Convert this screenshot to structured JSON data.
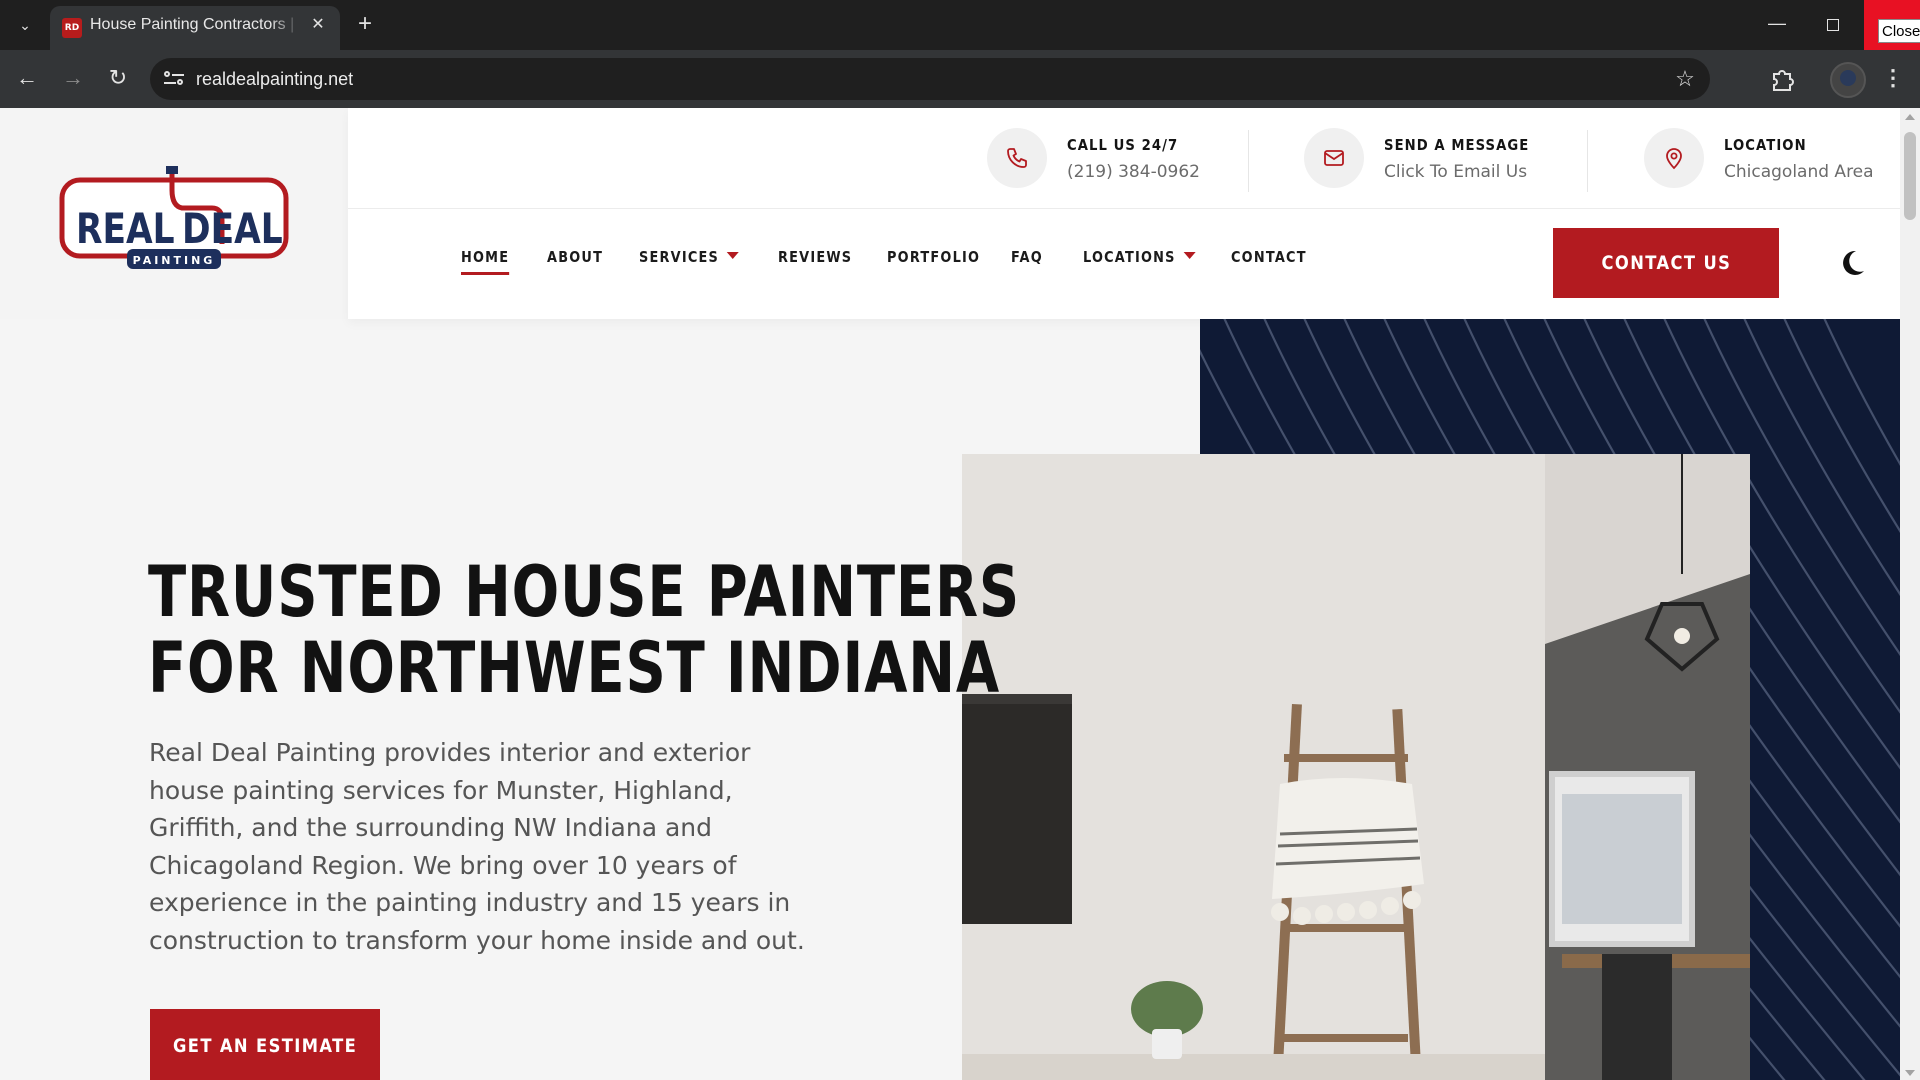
{
  "browser": {
    "tab_title": "House Painting Contractors | Real Deal Painting",
    "favicon_text": "RD",
    "url": "realdealpainting.net",
    "close_tooltip": "Close"
  },
  "logo": {
    "word_left": "REAL",
    "word_right": "DEAL",
    "sub": "PAINTING"
  },
  "topbar": [
    {
      "title": "CALL US 24/7",
      "sub": "(219) 384-0962",
      "icon": "phone-icon"
    },
    {
      "title": "SEND A MESSAGE",
      "sub": "Click To Email Us",
      "icon": "mail-icon"
    },
    {
      "title": "LOCATION",
      "sub": "Chicagoland Area",
      "icon": "location-pin-icon"
    }
  ],
  "nav": [
    {
      "label": "HOME",
      "active": true
    },
    {
      "label": "ABOUT"
    },
    {
      "label": "SERVICES",
      "dropdown": true
    },
    {
      "label": "REVIEWS"
    },
    {
      "label": "PORTFOLIO"
    },
    {
      "label": "FAQ"
    },
    {
      "label": "LOCATIONS",
      "dropdown": true
    },
    {
      "label": "CONTACT"
    }
  ],
  "cta": {
    "label": "CONTACT US"
  },
  "hero": {
    "title_line1": "TRUSTED HOUSE PAINTERS",
    "title_line2": "FOR NORTHWEST INDIANA",
    "description": "Real Deal Painting provides interior and exterior house painting services for Munster, Highland, Griffith, and the surrounding NW Indiana and Chicagoland Region. We bring over 10 years of experience in the painting industry and 15 years in construction to transform your home inside and out.",
    "button": "GET AN ESTIMATE"
  },
  "colors": {
    "brand_red": "#b31b20",
    "navy": "#0f1a35",
    "logo_blue": "#1d2f5c"
  }
}
